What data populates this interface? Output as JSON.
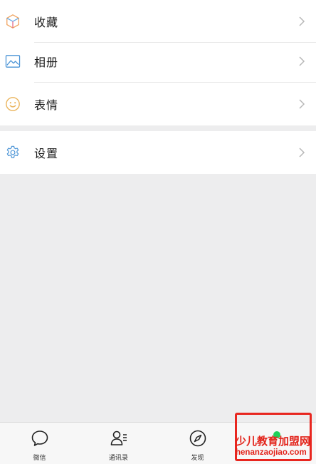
{
  "menu": {
    "items": [
      {
        "label": "收藏",
        "icon": "favorites-cube-icon"
      },
      {
        "label": "相册",
        "icon": "album-picture-icon"
      },
      {
        "label": "表情",
        "icon": "stickers-smiley-icon"
      }
    ],
    "settings": {
      "label": "设置",
      "icon": "settings-gear-icon"
    }
  },
  "tabbar": {
    "tabs": [
      {
        "label": "微信",
        "icon": "chat-bubble-icon"
      },
      {
        "label": "通讯录",
        "icon": "contacts-icon"
      },
      {
        "label": "发现",
        "icon": "compass-icon"
      },
      {
        "label": "",
        "icon": "me-tab-dot"
      }
    ]
  },
  "watermark": {
    "line1": "少儿教育加盟网",
    "line2": "henanzaojiao.com"
  },
  "colors": {
    "accent_green": "#1fd15a",
    "highlight_red": "#e8261f",
    "background": "#ededee"
  }
}
